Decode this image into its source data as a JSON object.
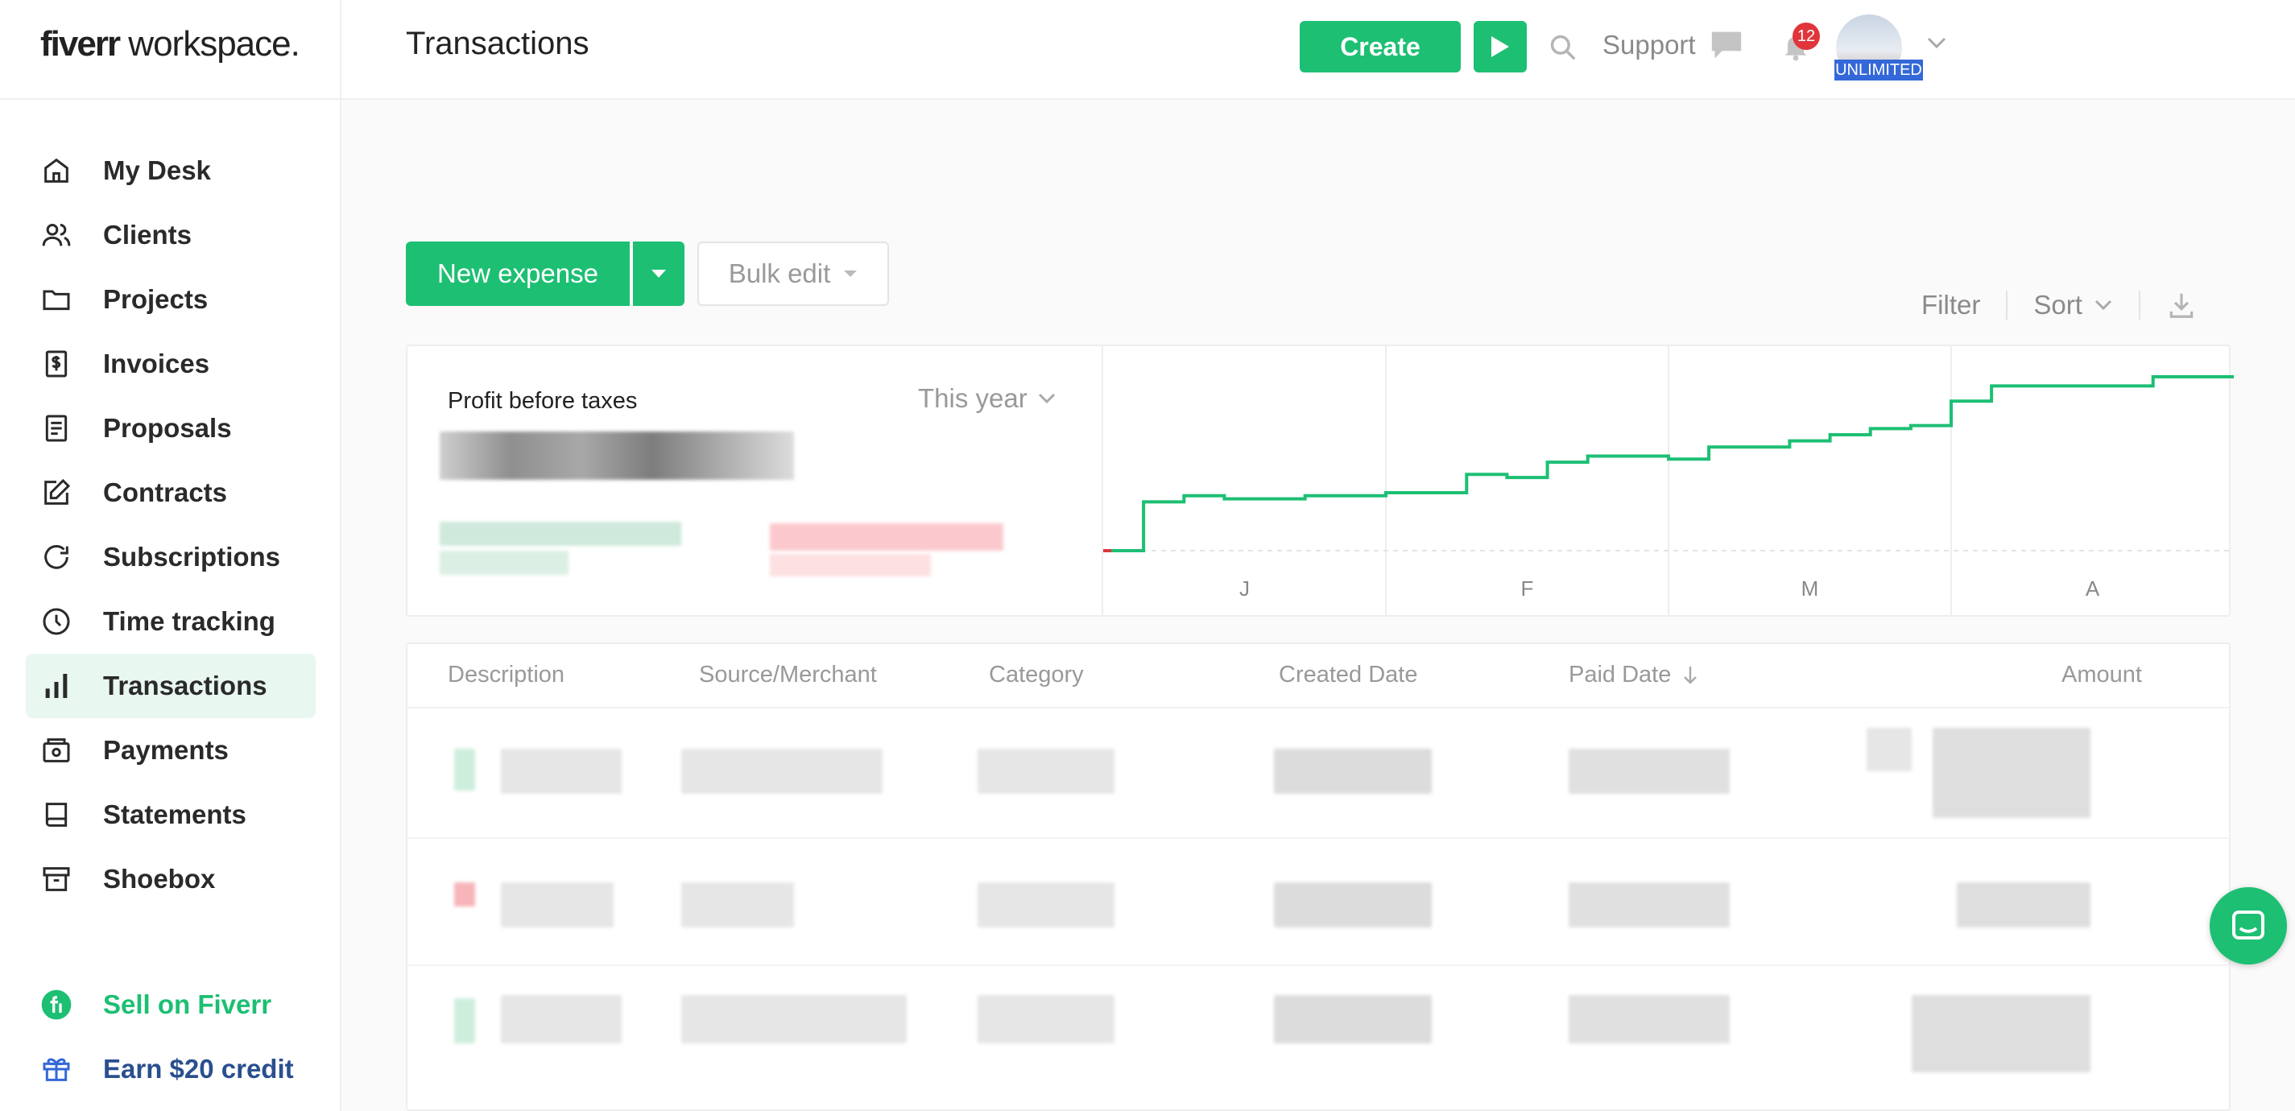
{
  "app": {
    "logo_bold": "fiverr",
    "logo_rest": " workspace."
  },
  "header": {
    "title": "Transactions",
    "create_label": "Create",
    "support_label": "Support",
    "notifications_count": "12",
    "plan_badge": "UNLIMITED"
  },
  "sidebar": {
    "items": [
      {
        "label": "My Desk",
        "icon": "home-icon"
      },
      {
        "label": "Clients",
        "icon": "users-icon"
      },
      {
        "label": "Projects",
        "icon": "folder-icon"
      },
      {
        "label": "Invoices",
        "icon": "invoice-icon"
      },
      {
        "label": "Proposals",
        "icon": "document-icon"
      },
      {
        "label": "Contracts",
        "icon": "edit-icon"
      },
      {
        "label": "Subscriptions",
        "icon": "refresh-icon"
      },
      {
        "label": "Time tracking",
        "icon": "clock-icon"
      },
      {
        "label": "Transactions",
        "icon": "bar-chart-icon",
        "active": true
      },
      {
        "label": "Payments",
        "icon": "wallet-icon"
      },
      {
        "label": "Statements",
        "icon": "book-icon"
      },
      {
        "label": "Shoebox",
        "icon": "archive-icon"
      }
    ],
    "sell_label": "Sell on Fiverr",
    "earn_label": "Earn $20 credit"
  },
  "toolbar": {
    "new_expense_label": "New expense",
    "bulk_edit_label": "Bulk edit",
    "filter_label": "Filter",
    "sort_label": "Sort"
  },
  "summary": {
    "title": "Profit before taxes",
    "period_label": "This year"
  },
  "chart_data": {
    "type": "line",
    "x_ticks": [
      "J",
      "F",
      "M",
      "A"
    ],
    "series": [
      {
        "values": [
          0,
          16,
          18,
          17,
          17,
          18,
          18,
          19,
          19,
          25,
          24,
          29,
          31,
          31,
          30,
          34,
          34,
          36,
          38,
          40,
          41,
          49,
          54,
          54,
          54,
          54,
          57,
          57
        ]
      }
    ],
    "grid": "vertical lines at month boundaries",
    "colors": {
      "line": "#1dbf73",
      "start": "#e0353b"
    }
  },
  "table": {
    "headers": [
      "Description",
      "Source/Merchant",
      "Category",
      "Created Date",
      "Paid Date",
      "Amount"
    ]
  },
  "colors": {
    "brand": "#1dbf73",
    "badge": "#e0353b",
    "active_bg": "#e8f7f0"
  }
}
